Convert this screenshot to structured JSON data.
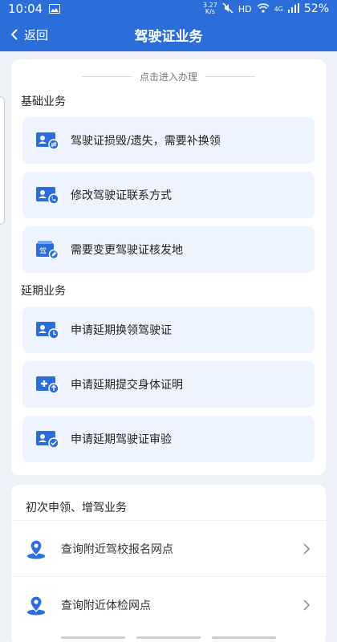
{
  "status": {
    "time": "10:04",
    "speed_top": "3.27",
    "speed_bottom": "K/s",
    "hd": "HD",
    "net": "4G",
    "battery": "52%"
  },
  "nav": {
    "back_label": "返回",
    "title": "驾驶证业务"
  },
  "main": {
    "hint": "点击进入办理",
    "sections": [
      {
        "title": "基础业务",
        "items": [
          {
            "label": "驾驶证损毁/遗失，需要补换领",
            "icon": "id-card-refresh-icon"
          },
          {
            "label": "修改驾驶证联系方式",
            "icon": "id-card-phone-icon"
          },
          {
            "label": "需要变更驾驶证核发地",
            "icon": "license-edit-icon"
          }
        ]
      },
      {
        "title": "延期业务",
        "items": [
          {
            "label": "申请延期换领驾驶证",
            "icon": "id-card-clock-icon"
          },
          {
            "label": "申请延期提交身体证明",
            "icon": "medical-upload-icon"
          },
          {
            "label": "申请延期驾驶证审验",
            "icon": "id-card-check-icon"
          }
        ]
      }
    ]
  },
  "secondary": {
    "title": "初次申领、增驾业务",
    "rows": [
      {
        "label": "查询附近驾校报名网点"
      },
      {
        "label": "查询附近体检网点"
      }
    ]
  },
  "colors": {
    "primary": "#2b6ed9",
    "item_bg": "#eef4ff",
    "page_bg": "#eef2f8"
  }
}
